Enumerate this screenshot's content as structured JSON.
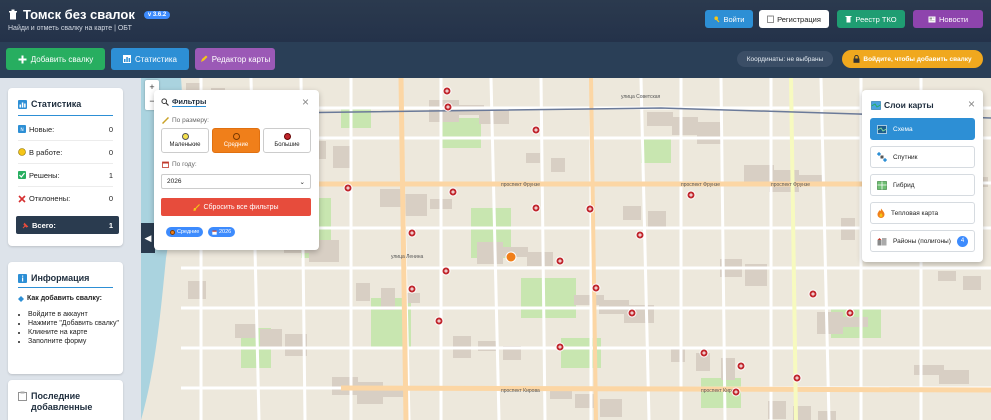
{
  "header": {
    "title": "Томск без свалок",
    "version": "v 3.6.2",
    "subtitle": "Найди и отметь свалку на карте | ОБТ",
    "buttons": {
      "login": "Войти",
      "register": "Регистрация",
      "registry": "Реестр ТКО",
      "news": "Новости"
    }
  },
  "toolbar": {
    "add_dump": "Добавить свалку",
    "statistics": "Статистика",
    "map_editor": "Редактор карты",
    "coords": "Координаты: не выбраны",
    "login_warning": "Войдите, чтобы добавить свалку"
  },
  "stats": {
    "title": "Статистика",
    "rows": [
      {
        "label": "Новые:",
        "value": "0"
      },
      {
        "label": "В работе:",
        "value": "0"
      },
      {
        "label": "Решены:",
        "value": "1"
      },
      {
        "label": "Отклонены:",
        "value": "0"
      }
    ],
    "total_label": "Всего:",
    "total_value": "1"
  },
  "info": {
    "title": "Информация",
    "heading": "Как добавить свалку:",
    "steps": [
      "Войдите в аккаунт",
      "Нажмите \"Добавить свалку\"",
      "Кликните на карте",
      "Заполните форму"
    ]
  },
  "recent": {
    "title": "Последние добавленные"
  },
  "map": {
    "zoom_in": "+",
    "zoom_out": "−",
    "street_labels": [
      "проспект Фрунзе",
      "проспект Фрунзе",
      "проспект Фрунзе",
      "проспект Кирова",
      "проспект Кирова",
      "улица Советская",
      "улица Ленина"
    ]
  },
  "filters": {
    "title": "Фильтры",
    "size_label": "По размеру:",
    "sizes": [
      {
        "label": "Маленькие",
        "color": "#f4e04d"
      },
      {
        "label": "Средние",
        "color": "#f07f1a"
      },
      {
        "label": "Большие",
        "color": "#c0262c"
      }
    ],
    "year_label": "По году:",
    "year_value": "2026",
    "reset": "Сбросить все фильтры",
    "chips": [
      "Средние",
      "2026"
    ]
  },
  "layers": {
    "title": "Слои карты",
    "items": [
      {
        "label": "Схема"
      },
      {
        "label": "Спутник"
      },
      {
        "label": "Гибрид"
      },
      {
        "label": "Тепловая карта"
      },
      {
        "label": "Районы (полигоны)",
        "badge": "4"
      }
    ]
  },
  "colors": {
    "login_btn": "#2d8fd5",
    "register_btn": "#ffffff",
    "registry_btn": "#1f9d72",
    "news_btn": "#8e44ad",
    "add_btn": "#27ae60",
    "stats_btn": "#2d8fd5",
    "editor_btn": "#9b59b6",
    "marker_red": "#c0262c",
    "marker_orange": "#f07f1a"
  }
}
